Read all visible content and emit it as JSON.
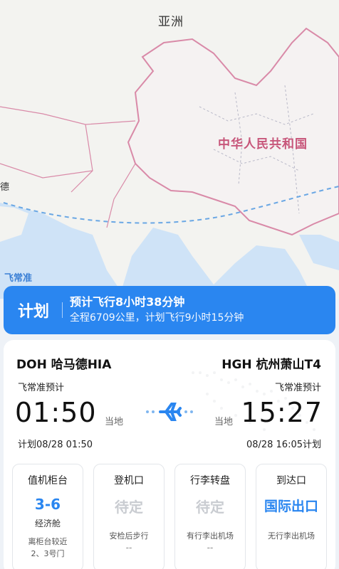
{
  "map": {
    "continent_label": "亚洲",
    "country_label": "中华人民共和国",
    "edge_label": "德",
    "watermark": "飞常准"
  },
  "plan": {
    "tag": "计划",
    "main": "预计飞行8小时38分钟",
    "sub": "全程6709公里，计划飞行9小时15分钟"
  },
  "flight": {
    "departure": {
      "airport": "DOH 哈马德HIA",
      "est_label": "飞常准预计",
      "time": "01:50",
      "local": "当地",
      "scheduled": "计划08/28 01:50"
    },
    "arrival": {
      "airport": "HGH 杭州萧山T4",
      "est_label": "飞常准预计",
      "time": "15:27",
      "local": "当地",
      "scheduled": "08/28 16:05计划"
    }
  },
  "tiles": [
    {
      "title": "值机柜台",
      "value": "3-6",
      "sub": "经济舱",
      "note1": "离柜台较近",
      "note2": "2、3号门"
    },
    {
      "title": "登机口",
      "value": "待定",
      "note1": "安检后步行",
      "note2": "--"
    },
    {
      "title": "行李转盘",
      "value": "待定",
      "note1": "有行李出机场",
      "note2": "--"
    },
    {
      "title": "到达口",
      "value": "国际出口",
      "note1": "无行李出机场"
    }
  ],
  "colors": {
    "accent": "#2a86f0",
    "border_line": "#d98aa8",
    "route_line": "#6aa7e4"
  }
}
